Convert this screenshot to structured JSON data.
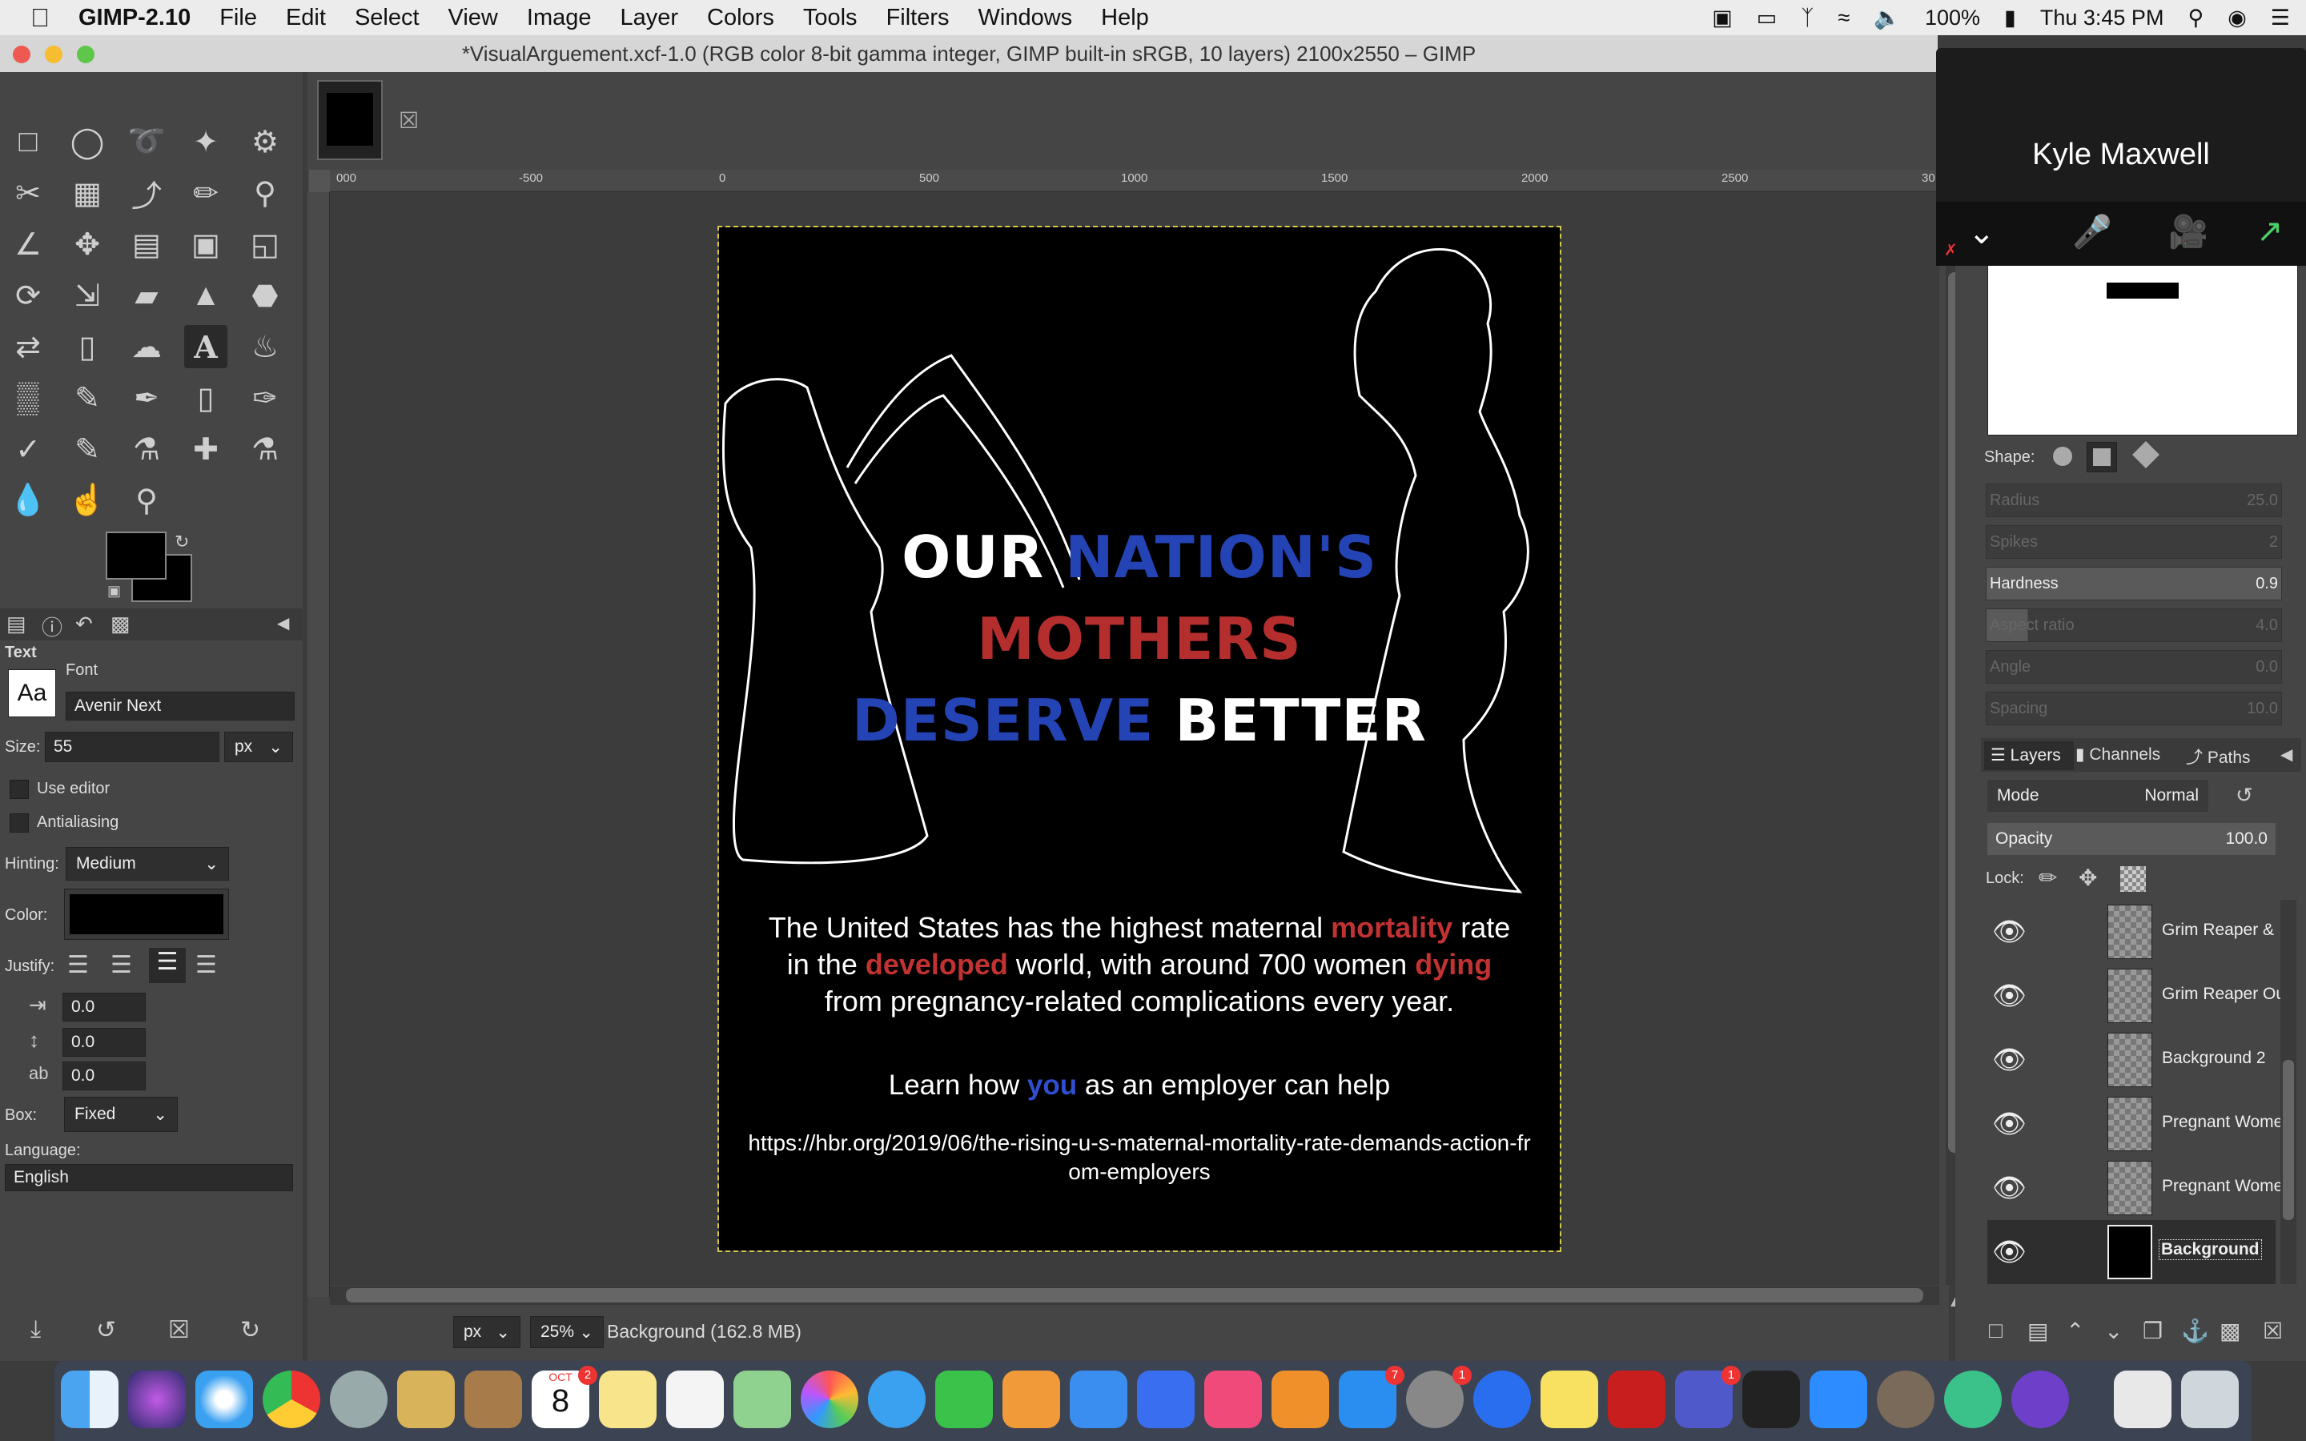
{
  "menubar": {
    "app_name": "GIMP-2.10",
    "items": [
      "File",
      "Edit",
      "Select",
      "View",
      "Image",
      "Layer",
      "Colors",
      "Tools",
      "Filters",
      "Windows",
      "Help"
    ],
    "battery": "100%",
    "clock": "Thu 3:45 PM"
  },
  "window": {
    "title": "*VisualArguement.xcf-1.0 (RGB color 8-bit gamma integer, GIMP built-in sRGB, 10 layers) 2100x2550 – GIMP"
  },
  "ruler": {
    "top_ticks": [
      "000",
      "-500",
      "0",
      "500",
      "1000",
      "1500",
      "2000",
      "2500",
      "30"
    ]
  },
  "canvas": {
    "headline": {
      "line1_a": "OUR ",
      "line1_b": "NATION'S",
      "line2": "MOTHERS",
      "line3_a": "DESERVE ",
      "line3_b": "BETTER"
    },
    "body": {
      "p1": "The United States has the highest maternal ",
      "w1": "mortality",
      "p2": " rate in the ",
      "w2": "developed",
      "p3": " world, with around 700 women ",
      "w3": "dying",
      "p4": " from pregnancy-related complications every year."
    },
    "cta": {
      "pre": "Learn how ",
      "you": "you",
      "post": " as an employer can help"
    },
    "url": "https://hbr.org/2019/06/the-rising-u-s-maternal-mortality-rate-demands-action-from-employers"
  },
  "tool_options": {
    "section": "Text",
    "font_label": "Font",
    "font_value": "Avenir Next",
    "font_preview": "Aa",
    "size_label": "Size:",
    "size_value": "55",
    "size_unit": "px",
    "use_editor": "Use editor",
    "antialiasing": "Antialiasing",
    "hinting_label": "Hinting:",
    "hinting_value": "Medium",
    "color_label": "Color:",
    "justify_label": "Justify:",
    "indent": "0.0",
    "line_spacing": "0.0",
    "letter_spacing": "0.0",
    "box_label": "Box:",
    "box_value": "Fixed",
    "language_label": "Language:",
    "language_value": "English"
  },
  "status": {
    "unit": "px",
    "zoom": "25%",
    "layer_info": "Background (162.8 MB)"
  },
  "video_call": {
    "name": "Kyle Maxwell"
  },
  "brush_options": {
    "shape_label": "Shape:",
    "sliders": [
      {
        "label": "Radius",
        "value": "25.0",
        "active": false
      },
      {
        "label": "Spikes",
        "value": "2",
        "active": false
      },
      {
        "label": "Hardness",
        "value": "0.9",
        "active": true
      },
      {
        "label": "Aspect ratio",
        "value": "4.0",
        "active": false
      },
      {
        "label": "Angle",
        "value": "0.0",
        "active": false
      },
      {
        "label": "Spacing",
        "value": "10.0",
        "active": false
      }
    ]
  },
  "layers_panel": {
    "tabs": [
      "Layers",
      "Channels",
      "Paths"
    ],
    "mode_label": "Mode",
    "mode_value": "Normal",
    "opacity_label": "Opacity",
    "opacity_value": "100.0",
    "lock_label": "Lock:",
    "layers": [
      "Grim Reaper &",
      "Grim Reaper Ou",
      "Background 2",
      "Pregnant Wome",
      "Pregnant Wome",
      "Background"
    ]
  },
  "dock": {
    "calendar_month": "OCT",
    "calendar_day": "8",
    "badges": [
      "2",
      "7",
      "1",
      "1"
    ]
  }
}
